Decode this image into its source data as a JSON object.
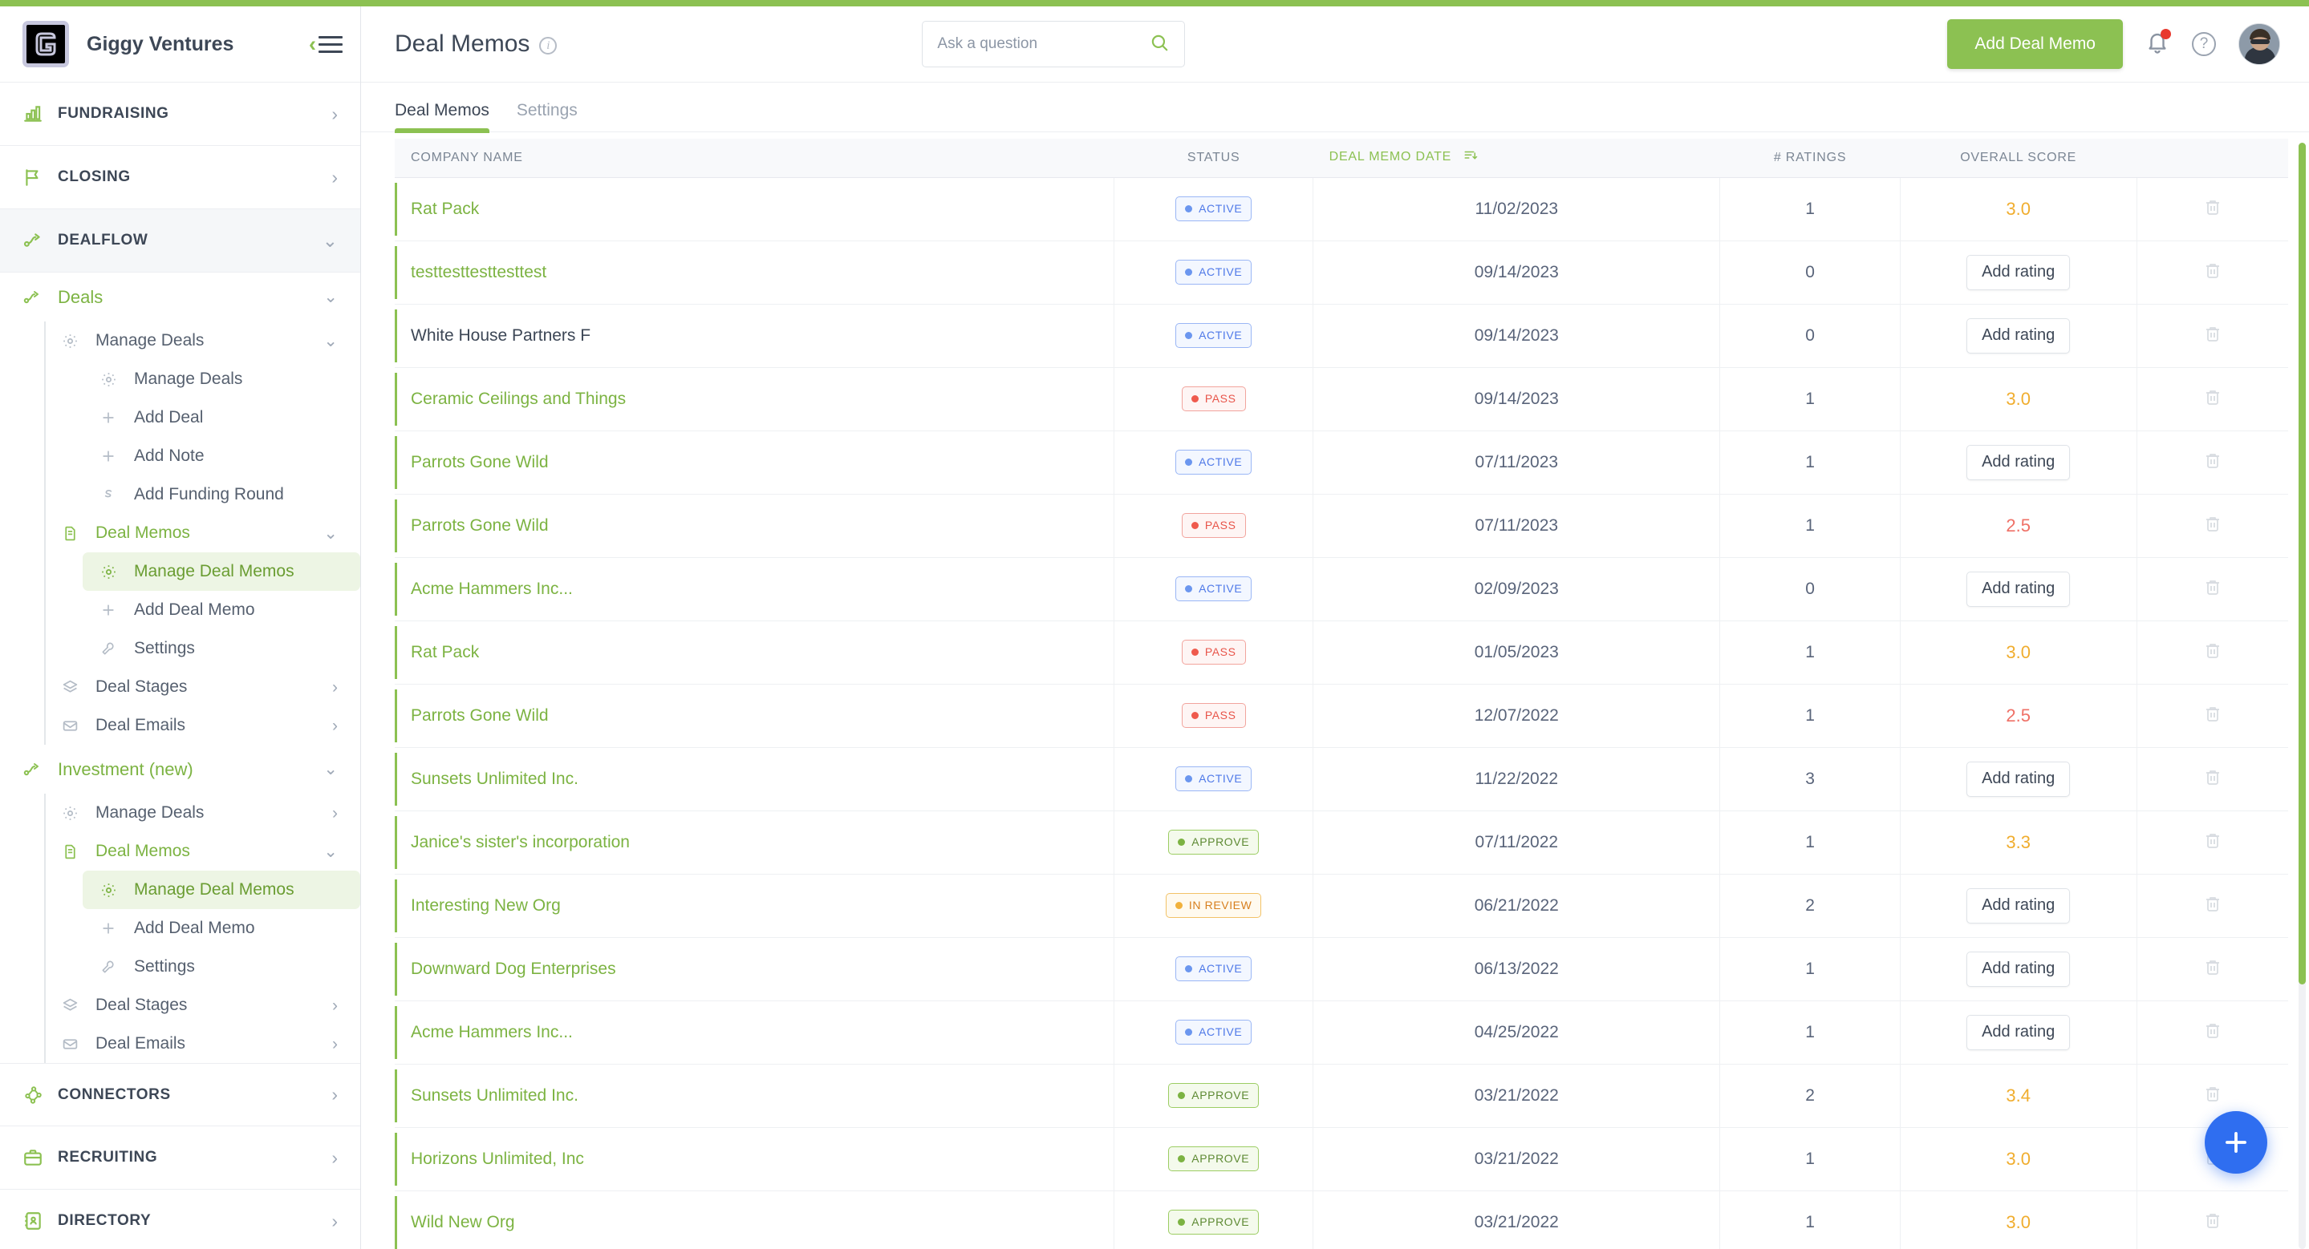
{
  "brand": {
    "name": "Giggy Ventures",
    "logo_glyph": "G"
  },
  "sidebar": {
    "sections": [
      {
        "label": "FUNDRAISING",
        "icon": "bar-chart-icon"
      },
      {
        "label": "CLOSING",
        "icon": "flag-icon"
      },
      {
        "label": "DEALFLOW",
        "icon": "deal-flow-icon",
        "active": true
      }
    ],
    "bottom_sections": [
      {
        "label": "CONNECTORS",
        "icon": "connectors-icon"
      },
      {
        "label": "RECRUITING",
        "icon": "briefcase-icon"
      },
      {
        "label": "DIRECTORY",
        "icon": "directory-icon"
      }
    ],
    "groups": [
      {
        "label": "Deals",
        "icon": "deal-flow-icon",
        "children": [
          {
            "label": "Manage Deals",
            "icon": "gear-icon",
            "expandable": true,
            "children": [
              {
                "label": "Manage Deals",
                "icon": "gear-icon"
              },
              {
                "label": "Add Deal",
                "icon": "plus-icon"
              },
              {
                "label": "Add Note",
                "icon": "plus-icon"
              },
              {
                "label": "Add Funding Round",
                "icon": "funding-icon"
              }
            ]
          },
          {
            "label": "Deal Memos",
            "icon": "document-icon",
            "expandable": true,
            "children": [
              {
                "label": "Manage Deal Memos",
                "icon": "gear-icon",
                "selected": true
              },
              {
                "label": "Add Deal Memo",
                "icon": "plus-icon"
              },
              {
                "label": "Settings",
                "icon": "wrench-icon"
              }
            ]
          },
          {
            "label": "Deal Stages",
            "icon": "layers-icon",
            "expandable": true
          },
          {
            "label": "Deal Emails",
            "icon": "envelope-icon",
            "expandable": true
          }
        ]
      },
      {
        "label": "Investment (new)",
        "icon": "deal-flow-icon",
        "children": [
          {
            "label": "Manage Deals",
            "icon": "gear-icon",
            "expandable": true
          },
          {
            "label": "Deal Memos",
            "icon": "document-icon",
            "expandable": true,
            "children": [
              {
                "label": "Manage Deal Memos",
                "icon": "gear-icon",
                "selected": true
              },
              {
                "label": "Add Deal Memo",
                "icon": "plus-icon"
              },
              {
                "label": "Settings",
                "icon": "wrench-icon"
              }
            ]
          },
          {
            "label": "Deal Stages",
            "icon": "layers-icon",
            "expandable": true
          },
          {
            "label": "Deal Emails",
            "icon": "envelope-icon",
            "expandable": true
          }
        ]
      }
    ]
  },
  "header": {
    "title": "Deal Memos",
    "info_icon": "info-icon",
    "search": {
      "placeholder": "Ask a question",
      "value": "",
      "icon": "search-icon"
    },
    "add_button": "Add Deal Memo",
    "bell_icon": "bell-icon",
    "help_icon": "help-icon",
    "avatar": "user-avatar"
  },
  "tabs": [
    {
      "label": "Deal Memos",
      "active": true
    },
    {
      "label": "Settings",
      "active": false
    }
  ],
  "table": {
    "columns": [
      "COMPANY NAME",
      "STATUS",
      "DEAL MEMO DATE",
      "# RATINGS",
      "OVERALL SCORE"
    ],
    "sorted_column": "DEAL MEMO DATE",
    "sort_direction": "desc",
    "add_rating_label": "Add rating",
    "rows": [
      {
        "company": "Rat Pack",
        "link": true,
        "status": "ACTIVE",
        "status_type": "active",
        "date": "11/02/2023",
        "ratings": "1",
        "score": "3.0",
        "score_tone": "amber"
      },
      {
        "company": "testtesttesttesttest",
        "link": true,
        "status": "ACTIVE",
        "status_type": "active",
        "date": "09/14/2023",
        "ratings": "0",
        "score": null,
        "score_tone": null
      },
      {
        "company": "White House Partners F",
        "link": false,
        "status": "ACTIVE",
        "status_type": "active",
        "date": "09/14/2023",
        "ratings": "0",
        "score": null,
        "score_tone": null
      },
      {
        "company": "Ceramic Ceilings and Things",
        "link": true,
        "status": "PASS",
        "status_type": "pass",
        "date": "09/14/2023",
        "ratings": "1",
        "score": "3.0",
        "score_tone": "amber"
      },
      {
        "company": "Parrots Gone Wild",
        "link": true,
        "status": "ACTIVE",
        "status_type": "active",
        "date": "07/11/2023",
        "ratings": "1",
        "score": null,
        "score_tone": null
      },
      {
        "company": "Parrots Gone Wild",
        "link": true,
        "status": "PASS",
        "status_type": "pass",
        "date": "07/11/2023",
        "ratings": "1",
        "score": "2.5",
        "score_tone": "red"
      },
      {
        "company": "Acme Hammers Inc...",
        "link": true,
        "status": "ACTIVE",
        "status_type": "active",
        "date": "02/09/2023",
        "ratings": "0",
        "score": null,
        "score_tone": null
      },
      {
        "company": "Rat Pack",
        "link": true,
        "status": "PASS",
        "status_type": "pass",
        "date": "01/05/2023",
        "ratings": "1",
        "score": "3.0",
        "score_tone": "amber"
      },
      {
        "company": "Parrots Gone Wild",
        "link": true,
        "status": "PASS",
        "status_type": "pass",
        "date": "12/07/2022",
        "ratings": "1",
        "score": "2.5",
        "score_tone": "red"
      },
      {
        "company": "Sunsets Unlimited Inc.",
        "link": true,
        "status": "ACTIVE",
        "status_type": "active",
        "date": "11/22/2022",
        "ratings": "3",
        "score": null,
        "score_tone": null
      },
      {
        "company": "Janice's sister's incorporation",
        "link": true,
        "status": "APPROVE",
        "status_type": "approve",
        "date": "07/11/2022",
        "ratings": "1",
        "score": "3.3",
        "score_tone": "amber"
      },
      {
        "company": "Interesting New Org",
        "link": true,
        "status": "IN REVIEW",
        "status_type": "review",
        "date": "06/21/2022",
        "ratings": "2",
        "score": null,
        "score_tone": null
      },
      {
        "company": "Downward Dog Enterprises",
        "link": true,
        "status": "ACTIVE",
        "status_type": "active",
        "date": "06/13/2022",
        "ratings": "1",
        "score": null,
        "score_tone": null
      },
      {
        "company": "Acme Hammers Inc...",
        "link": true,
        "status": "ACTIVE",
        "status_type": "active",
        "date": "04/25/2022",
        "ratings": "1",
        "score": null,
        "score_tone": null
      },
      {
        "company": "Sunsets Unlimited Inc.",
        "link": true,
        "status": "APPROVE",
        "status_type": "approve",
        "date": "03/21/2022",
        "ratings": "2",
        "score": "3.4",
        "score_tone": "amber"
      },
      {
        "company": "Horizons Unlimited, Inc",
        "link": true,
        "status": "APPROVE",
        "status_type": "approve",
        "date": "03/21/2022",
        "ratings": "1",
        "score": "3.0",
        "score_tone": "amber"
      },
      {
        "company": "Wild New Org",
        "link": true,
        "status": "APPROVE",
        "status_type": "approve",
        "date": "03/21/2022",
        "ratings": "1",
        "score": "3.0",
        "score_tone": "amber"
      }
    ]
  },
  "fab": {
    "icon": "plus-icon",
    "label": "+"
  },
  "colors": {
    "brand_green": "#8cc152",
    "link_green": "#7cb342",
    "status_active": "#4f79e8",
    "status_pass": "#e8554a",
    "status_approve": "#5e8a33",
    "status_review": "#d77f1e",
    "score_amber": "#f0ad2e",
    "score_red": "#ef7066",
    "fab_blue": "#2f6ef0"
  }
}
